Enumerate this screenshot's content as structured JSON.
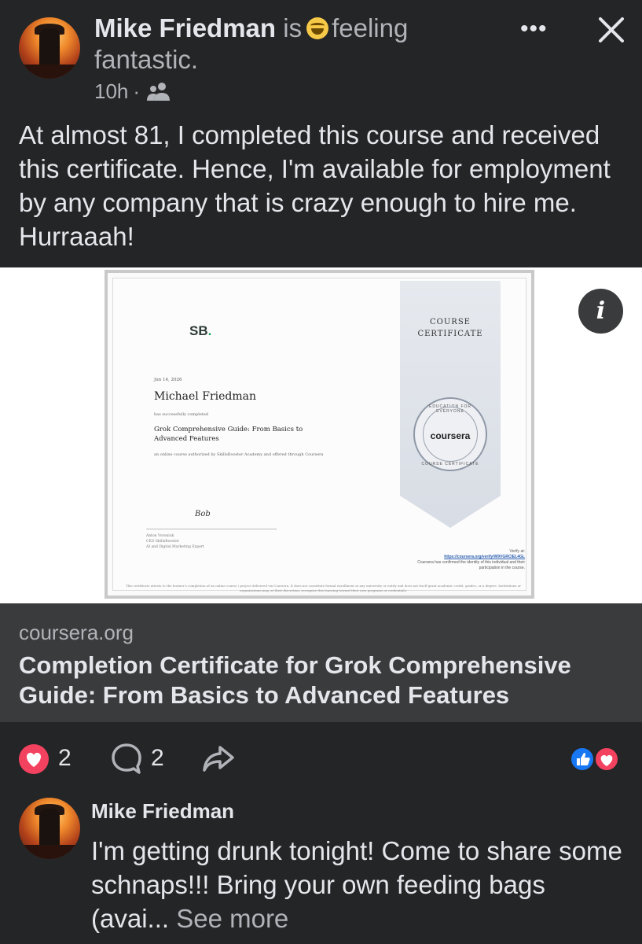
{
  "post": {
    "author": "Mike Friedman",
    "activity_prefix": "is",
    "activity_feeling": "feeling",
    "activity_state": "fantastic.",
    "emoji": "grinning-face-icon",
    "time": "10h",
    "time_sep": "·",
    "audience_icon": "friends-icon",
    "text": "At almost 81, I completed this course and received this certificate. Hence, I'm available for employment by any company that is crazy enough to hire me. Hurraaah!"
  },
  "toolbar": {
    "more_label": "•••",
    "more_icon": "more-options-icon",
    "close_icon": "close-icon"
  },
  "certificate": {
    "logo": "SB",
    "logo_dot": ".",
    "ribbon_title": "COURSE\nCERTIFICATE",
    "date": "Jun 14, 2026",
    "recipient": "Michael Friedman",
    "completed_text": "has successfully completed",
    "course_name": "Grok Comprehensive Guide: From Basics to Advanced Features",
    "course_desc": "an online course authorized by SkillsBooster Academy and offered through Coursera",
    "signature": "Bob",
    "signer_name": "Anton Voroniuk",
    "signer_role1": "CEO SkillsBooster",
    "signer_role2": "AI and Digital Marketing Expert",
    "seal_top": "EDUCATION FOR EVERYONE",
    "seal_word": "coursera",
    "seal_bottom": "COURSE CERTIFICATE",
    "verify_label": "Verify at:",
    "verify_url": "https://coursera.org/verify/W9VGRCIEL4GL",
    "verify_note": "Coursera has confirmed the identity of this individual and their participation in the course.",
    "footer": "This certificate attests to the learner's completion of an online course / project delivered via Coursera. It does not constitute formal enrollment at any university or entity and does not itself grant academic credit, grades, or a degree. Institutions or organizations may, at their discretion, recognize this learning toward their own programs or credentials.",
    "info_label": "i"
  },
  "link": {
    "domain": "coursera.org",
    "title": "Completion Certificate for Grok Comprehensive Guide: From Basics to Advanced Features"
  },
  "actions": {
    "reactions_count": "2",
    "comments_count": "2",
    "colors": {
      "love": "#f3425f",
      "like": "#1877f2"
    }
  },
  "comment": {
    "author": "Mike Friedman",
    "text": "I'm getting drunk tonight! Come to share some schnaps!!! Bring your own feeding bags (avai...",
    "see_more": "See more"
  }
}
